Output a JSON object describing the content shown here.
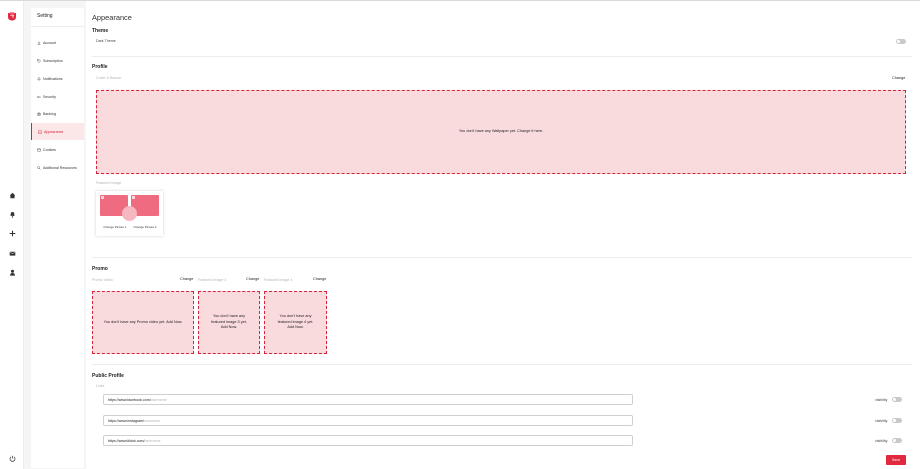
{
  "menu": {
    "title": "Setting",
    "items": [
      {
        "label": "Account",
        "icon": "download-icon"
      },
      {
        "label": "Subscription",
        "icon": "tag-icon"
      },
      {
        "label": "Notifications",
        "icon": "bell-icon"
      },
      {
        "label": "Security",
        "icon": "key-icon"
      },
      {
        "label": "Banking",
        "icon": "bank-icon"
      },
      {
        "label": "Appearance",
        "icon": "image-icon",
        "active": true
      },
      {
        "label": "Cookies",
        "icon": "cookie-icon"
      },
      {
        "label": "Additional Resources",
        "icon": "search-icon"
      }
    ]
  },
  "rail": {
    "logo": "brand-logo",
    "icons": [
      "home-icon",
      "bell-icon",
      "plus-icon",
      "mail-icon",
      "user-icon",
      "power-icon"
    ]
  },
  "appearance": {
    "title": "Appearance",
    "theme": {
      "heading": "Theme",
      "dark_theme_label": "Dark Theme",
      "dark_theme_on": false
    },
    "profile": {
      "heading": "Profile",
      "cover_label": "Cover & Banner",
      "change_label": "Change",
      "wallpaper_text": "You don't have any Wallpaper yet. Change it here.",
      "featured_label": "Featured Image",
      "change_picture_1": "Change Picture 1",
      "change_picture_2": "Change Picture 2"
    },
    "promo": {
      "heading": "Promo",
      "promo_video_label": "Promo Video",
      "featured_image_3_label": "Featured Image 3",
      "featured_image_4_label": "Featured Image 4",
      "change_label": "Change",
      "promo_video_text": "You don't have any Promo video yet. Add Now.",
      "featured_image_3_text": "You don't have any featured image 3 yet. Add Now.",
      "featured_image_4_text": "You don't have any featured image 4 yet. Add Now."
    },
    "public_profile": {
      "heading": "Public Profile",
      "links_label": "Links",
      "links": [
        {
          "prefix": "https://www.facebook.com/",
          "placeholder": "username",
          "visibility_label": "visibility",
          "visible": false
        },
        {
          "prefix": "https://www.instagram/",
          "placeholder": "username",
          "visibility_label": "visibility",
          "visible": false
        },
        {
          "prefix": "https://www.tiktok.com/",
          "placeholder": "username",
          "visibility_label": "visibility",
          "visible": false
        }
      ]
    },
    "save_label": "Save"
  },
  "colors": {
    "accent": "#e0283f",
    "dropzone_fill": "#f9dadd",
    "featured_image": "#ef6b7f"
  }
}
